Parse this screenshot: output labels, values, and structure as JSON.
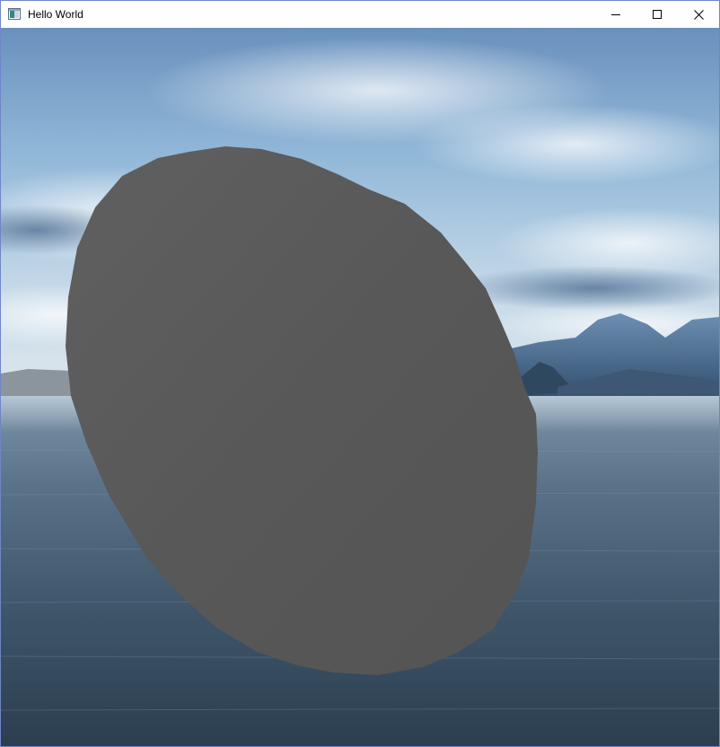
{
  "window": {
    "title": "Hello World",
    "border_color": "#6f86c9"
  },
  "titlebar": {
    "app_icon": "window-app-icon",
    "buttons": [
      {
        "name": "minimize",
        "icon": "minimize-icon"
      },
      {
        "name": "maximize",
        "icon": "maximize-icon"
      },
      {
        "name": "close",
        "icon": "close-icon"
      }
    ]
  },
  "scene": {
    "sky_colors": [
      "#5d86b3",
      "#9ec2df",
      "#d9e7f1"
    ],
    "water_colors": [
      "#6d879e",
      "#2e4256"
    ],
    "mountain_color": "#3d5f83",
    "object_color": "#595959"
  }
}
